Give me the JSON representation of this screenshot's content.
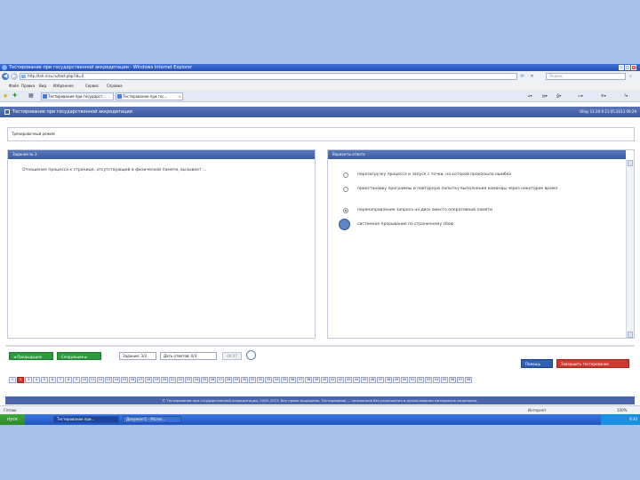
{
  "window": {
    "title": "Тестирование при государственной аккредитации - Windows Internet Explorer",
    "controls": {
      "minimize": "–",
      "maximize": "□",
      "close": "×"
    }
  },
  "address_bar": {
    "url": "http://tsh.rcsu.ru/test.php?id=0",
    "search_placeholder": "Яндекс",
    "back_glyph": "◀",
    "forward_glyph": "▶"
  },
  "menu": [
    "Файл",
    "Правка",
    "Вид",
    "Избранное",
    "Сервис",
    "Справка"
  ],
  "tabs": [
    {
      "label": "Тестирование при государст...",
      "active": false
    },
    {
      "label": "Тестирование при гос...",
      "active": true
    }
  ],
  "app": {
    "title": "Тестирование при государственной аккредитации",
    "datetime": "Ollay 11:30:9 21.05.2013 09:29",
    "mode_label": "Тренировочный режим"
  },
  "question": {
    "header": "Задание № 3.",
    "text": "Отношение процесса к странице, отсутствующей в физической памяти, вызывает ..."
  },
  "answers": {
    "header": "Варианты ответа",
    "options": [
      {
        "text": "перезагрузку процесса и запуск с точки, на которой произошла ошибка",
        "selected": false
      },
      {
        "text": "приостановку программы и повторную попытку выполнения команды через некоторое время",
        "selected": false
      },
      {
        "text": "перенаправление запроса на диск вместо оперативной памяти",
        "selected": true
      },
      {
        "text": "системное прерывание по страничному сбою",
        "selected": false
      }
    ]
  },
  "controls": {
    "prev_label": "◄ Предыдущее",
    "next_label": "Следующее ►",
    "task_field": "Задание: 3/3",
    "total_field": "Дать ответов: 0/3",
    "timer": "00:47",
    "help_label": "Помощь",
    "finish_label": "Завершить тестирование"
  },
  "question_numbers": [
    "1",
    "2",
    "3",
    "4",
    "5",
    "6",
    "7",
    "8",
    "9",
    "10",
    "11",
    "12",
    "13",
    "14",
    "15",
    "16",
    "17",
    "18",
    "19",
    "20",
    "21",
    "22",
    "23",
    "24",
    "25",
    "26",
    "27",
    "28",
    "29",
    "30",
    "31",
    "32",
    "33",
    "34",
    "35",
    "36",
    "37",
    "38",
    "39",
    "40",
    "41",
    "42",
    "43",
    "44",
    "45",
    "46",
    "47",
    "48",
    "49",
    "50",
    "51",
    "52",
    "53",
    "54",
    "55",
    "56",
    "57",
    "58"
  ],
  "current_question": 2,
  "footer": "© Тестирование при государственной аккредитации, 2005–2013. Все права защищены. Тестирование — незаконное без разрешения и использование материалов запрещено.",
  "status_bar": {
    "left": "Готово",
    "zone": "Интернет",
    "zoom": "100%"
  },
  "taskbar": {
    "start": "пуск",
    "items": [
      {
        "label": "Тестирование при...",
        "active": true
      },
      {
        "label": "Документ1 - Micros...",
        "active": false
      }
    ],
    "clock": "9:30"
  }
}
